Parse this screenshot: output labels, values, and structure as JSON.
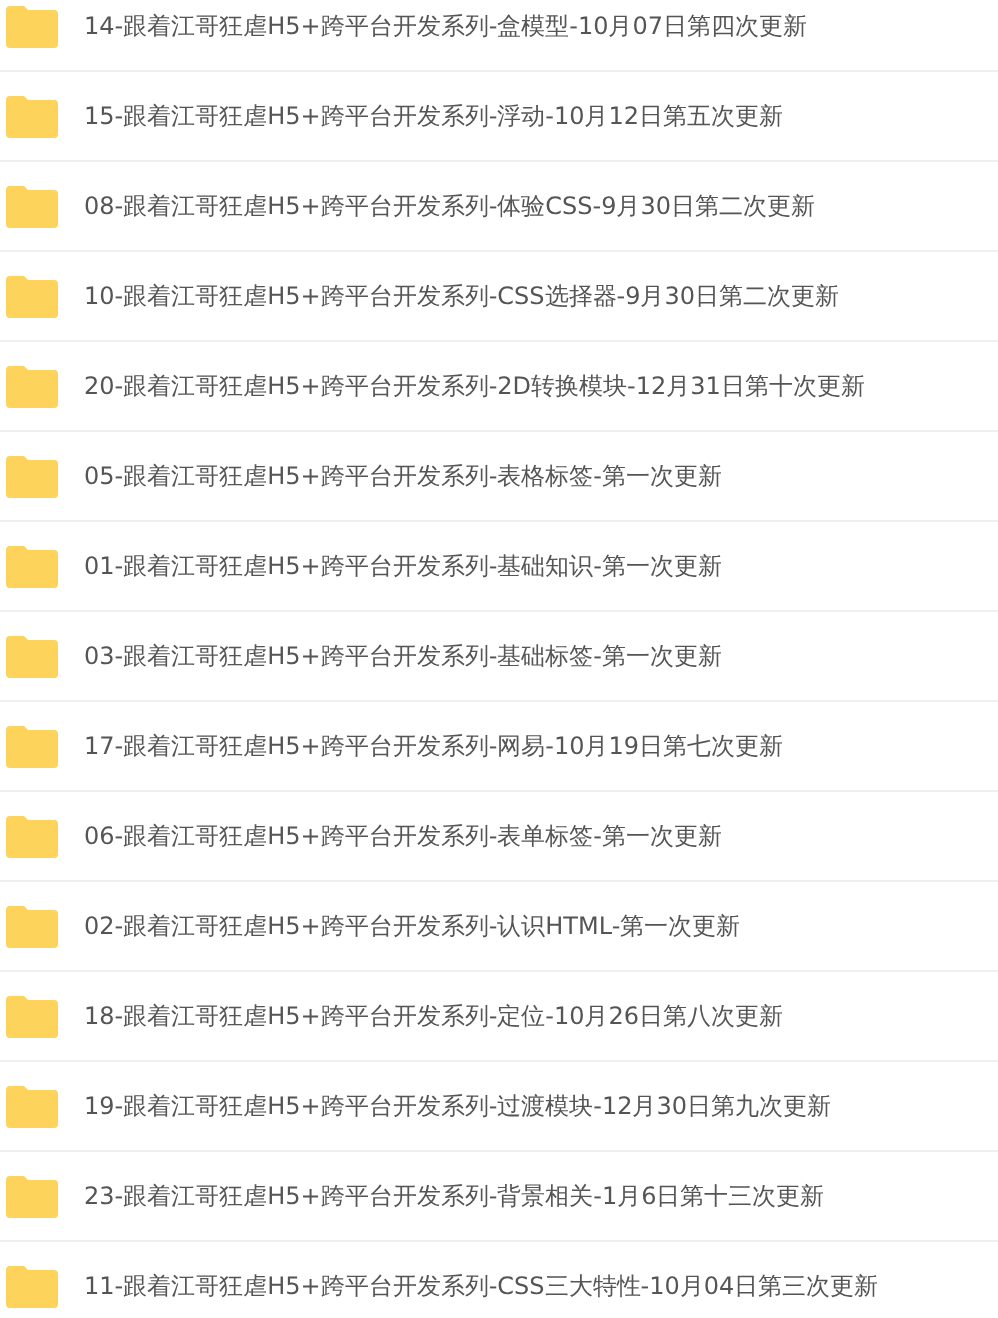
{
  "folders": [
    {
      "name": "14-跟着江哥狂虐H5+跨平台开发系列-盒模型-10月07日第四次更新"
    },
    {
      "name": "15-跟着江哥狂虐H5+跨平台开发系列-浮动-10月12日第五次更新"
    },
    {
      "name": "08-跟着江哥狂虐H5+跨平台开发系列-体验CSS-9月30日第二次更新"
    },
    {
      "name": "10-跟着江哥狂虐H5+跨平台开发系列-CSS选择器-9月30日第二次更新"
    },
    {
      "name": "20-跟着江哥狂虐H5+跨平台开发系列-2D转换模块-12月31日第十次更新"
    },
    {
      "name": "05-跟着江哥狂虐H5+跨平台开发系列-表格标签-第一次更新"
    },
    {
      "name": "01-跟着江哥狂虐H5+跨平台开发系列-基础知识-第一次更新"
    },
    {
      "name": "03-跟着江哥狂虐H5+跨平台开发系列-基础标签-第一次更新"
    },
    {
      "name": "17-跟着江哥狂虐H5+跨平台开发系列-网易-10月19日第七次更新"
    },
    {
      "name": "06-跟着江哥狂虐H5+跨平台开发系列-表单标签-第一次更新"
    },
    {
      "name": "02-跟着江哥狂虐H5+跨平台开发系列-认识HTML-第一次更新"
    },
    {
      "name": "18-跟着江哥狂虐H5+跨平台开发系列-定位-10月26日第八次更新"
    },
    {
      "name": "19-跟着江哥狂虐H5+跨平台开发系列-过渡模块-12月30日第九次更新"
    },
    {
      "name": "23-跟着江哥狂虐H5+跨平台开发系列-背景相关-1月6日第十三次更新"
    },
    {
      "name": "11-跟着江哥狂虐H5+跨平台开发系列-CSS三大特性-10月04日第三次更新"
    }
  ]
}
